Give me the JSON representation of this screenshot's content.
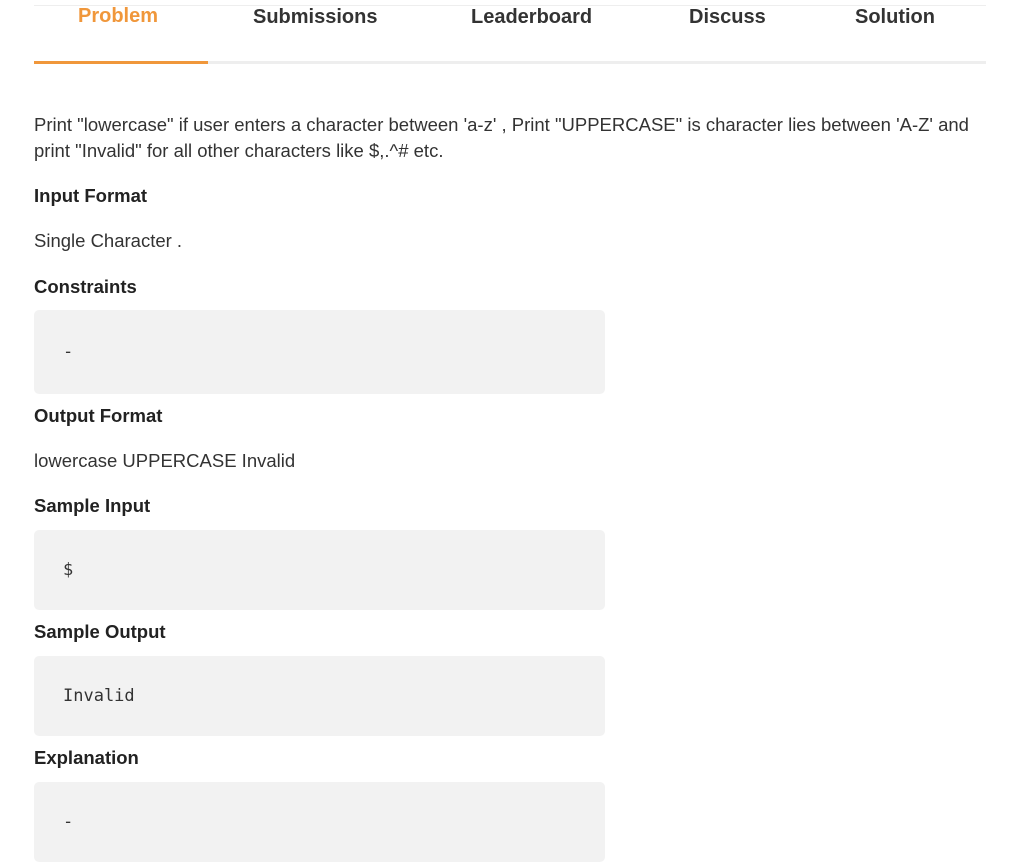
{
  "tabs": [
    {
      "label": "Problem",
      "active": true
    },
    {
      "label": "Submissions",
      "active": false
    },
    {
      "label": "Leaderboard",
      "active": false
    },
    {
      "label": "Discuss",
      "active": false
    },
    {
      "label": "Solution",
      "active": false
    }
  ],
  "accent_color": "#f0973b",
  "problem": {
    "description": "Print \"lowercase\" if user enters a character between 'a-z' , Print \"UPPERCASE\" is character lies between 'A-Z' and print \"Invalid\" for all other characters like $,.^# etc.",
    "input_format": {
      "heading": "Input Format",
      "text": "Single Character ."
    },
    "constraints": {
      "heading": "Constraints",
      "code": "-"
    },
    "output_format": {
      "heading": "Output Format",
      "text": "lowercase UPPERCASE Invalid"
    },
    "sample_input": {
      "heading": "Sample Input",
      "code": "$"
    },
    "sample_output": {
      "heading": "Sample Output",
      "code": "Invalid"
    },
    "explanation": {
      "heading": "Explanation",
      "code": "-"
    }
  }
}
